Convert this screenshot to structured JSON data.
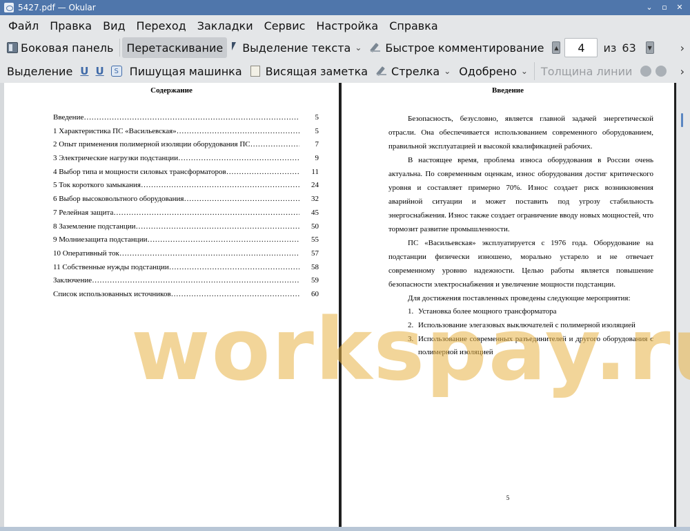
{
  "window": {
    "title": "5427.pdf  — Okular",
    "buttons": [
      "⌄",
      "▫",
      "✕"
    ]
  },
  "menu": [
    "Файл",
    "Правка",
    "Вид",
    "Переход",
    "Закладки",
    "Сервис",
    "Настройка",
    "Справка"
  ],
  "toolbar1": {
    "sidebar": "Боковая панель",
    "drag": "Перетаскивание",
    "text_select": "Выделение текста",
    "quick_comment": "Быстрое комментирование",
    "page_current": "4",
    "page_of": "из",
    "page_total": "63",
    "more": "›"
  },
  "toolbar2": {
    "selection": "Выделение",
    "typewriter": "Пишущая машинка",
    "sticky_note": "Висящая заметка",
    "arrow": "Стрелка",
    "stamp": "Одобрено",
    "line_width": "Толщина линии",
    "more": "›"
  },
  "left_page": {
    "title": "Содержание",
    "toc": [
      {
        "text": "Введение",
        "page": "5"
      },
      {
        "text": "1 Характеристика ПС «Васильевская»",
        "page": "5"
      },
      {
        "text": "2 Опыт применения полимерной изоляции оборудования ПС",
        "page": "7"
      },
      {
        "text": "3 Электрические нагрузки подстанции",
        "page": "9"
      },
      {
        "text": "4 Выбор типа и мощности силовых трансформаторов",
        "page": "11"
      },
      {
        "text": "5 Ток короткого замыкания",
        "page": "24"
      },
      {
        "text": "6 Выбор высоковольтного оборудования",
        "page": "32"
      },
      {
        "text": "7 Релейная защита",
        "page": "45"
      },
      {
        "text": "8 Заземление подстанции",
        "page": "50"
      },
      {
        "text": "9 Молниезащита подстанции",
        "page": "55"
      },
      {
        "text": "10 Оперативный ток",
        "page": "57"
      },
      {
        "text": "11 Собственные нужды подстанции",
        "page": "58"
      },
      {
        "text": "Заключение",
        "page": "59"
      },
      {
        "text": "Список использованных источников",
        "page": "60"
      }
    ]
  },
  "right_page": {
    "title": "Введение",
    "paragraphs": [
      "Безопасность, безусловно, является главной задачей энергетической отрасли. Она обеспечивается использованием современного оборудованием, правильной эксплуатацией и высокой квалификацией рабочих.",
      "В настоящее время, проблема износа оборудования в России очень актуальна. По современным оценкам, износ оборудования достиг критического уровня и составляет примерно 70%. Износ создает риск возникновения аварийной ситуации и может поставить под угрозу стабильность энергоснабжения. Износ также создает ограничение вводу новых мощностей, что тормозит развитие промышленности.",
      "ПС «Васильевская» эксплуатируется с 1976 года. Оборудование на подстанции физически изношено, морально устарело и не отвечает современному уровню надежности. Целью работы является повышение безопасности электроснабжения и увеличение мощности подстанции.",
      "Для достижения поставленных проведены следующие мероприятия:"
    ],
    "list": [
      {
        "num": "1.",
        "text": "Установка более мощного трансформатора"
      },
      {
        "num": "2.",
        "text": "Использование элегазовых выключателей с полимерной изоляцией"
      },
      {
        "num": "3.",
        "text": "Использование современных разъединителей и другого оборудования с полимерной изоляцией"
      }
    ],
    "page_number": "5"
  },
  "watermark": "workspay.ru"
}
